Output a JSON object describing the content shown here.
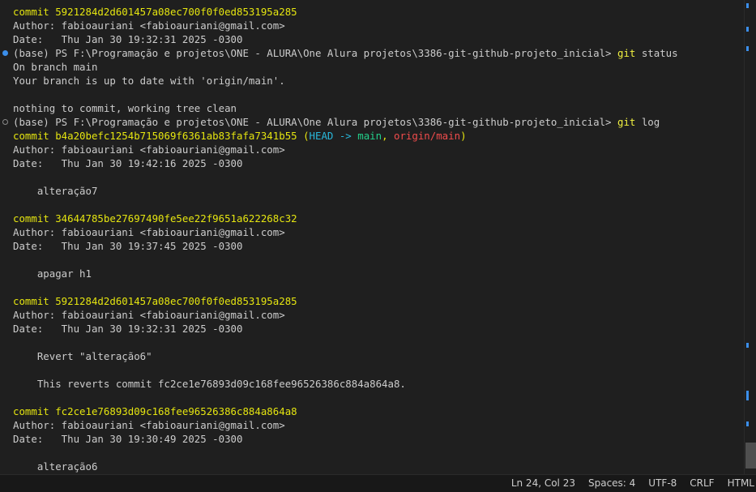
{
  "terminal": {
    "lines": [
      {
        "marker": "",
        "segments": [
          {
            "text": "commit 5921284d2d601457a08ec700f0f0ed853195a285",
            "cls": "c-commit"
          }
        ]
      },
      {
        "marker": "",
        "segments": [
          {
            "text": "Author: fabioauriani <fabioauriani@gmail.com>",
            "cls": "c-default"
          }
        ]
      },
      {
        "marker": "",
        "segments": [
          {
            "text": "Date:   Thu Jan 30 19:32:31 2025 -0300",
            "cls": "c-default"
          }
        ]
      },
      {
        "marker": "filled",
        "segments": [
          {
            "text": "(base) PS F:\\Programação e projetos\\ONE - ALURA\\One Alura projetos\\3386-git-github-projeto_inicial> ",
            "cls": "c-default"
          },
          {
            "text": "git",
            "cls": "c-cmd"
          },
          {
            "text": " status",
            "cls": "c-default"
          }
        ]
      },
      {
        "marker": "",
        "segments": [
          {
            "text": "On branch main",
            "cls": "c-default"
          }
        ]
      },
      {
        "marker": "",
        "segments": [
          {
            "text": "Your branch is up to date with 'origin/main'.",
            "cls": "c-default"
          }
        ]
      },
      {
        "marker": "",
        "segments": [
          {
            "text": "",
            "cls": "c-default"
          }
        ]
      },
      {
        "marker": "",
        "segments": [
          {
            "text": "nothing to commit, working tree clean",
            "cls": "c-default"
          }
        ]
      },
      {
        "marker": "hollow",
        "segments": [
          {
            "text": "(base) PS F:\\Programação e projetos\\ONE - ALURA\\One Alura projetos\\3386-git-github-projeto_inicial> ",
            "cls": "c-default"
          },
          {
            "text": "git",
            "cls": "c-cmd"
          },
          {
            "text": " log",
            "cls": "c-default"
          }
        ]
      },
      {
        "marker": "",
        "segments": [
          {
            "text": "commit b4a20befc1254b715069f6361ab83fafa7341b55 ",
            "cls": "c-commit"
          },
          {
            "text": "(",
            "cls": "c-commit"
          },
          {
            "text": "HEAD -> ",
            "cls": "c-head"
          },
          {
            "text": "main",
            "cls": "c-branch"
          },
          {
            "text": ", ",
            "cls": "c-commit"
          },
          {
            "text": "origin/main",
            "cls": "c-remote"
          },
          {
            "text": ")",
            "cls": "c-commit"
          }
        ]
      },
      {
        "marker": "",
        "segments": [
          {
            "text": "Author: fabioauriani <fabioauriani@gmail.com>",
            "cls": "c-default"
          }
        ]
      },
      {
        "marker": "",
        "segments": [
          {
            "text": "Date:   Thu Jan 30 19:42:16 2025 -0300",
            "cls": "c-default"
          }
        ]
      },
      {
        "marker": "",
        "segments": [
          {
            "text": "",
            "cls": "c-default"
          }
        ]
      },
      {
        "marker": "",
        "segments": [
          {
            "text": "    alteração7",
            "cls": "c-default"
          }
        ]
      },
      {
        "marker": "",
        "segments": [
          {
            "text": "",
            "cls": "c-default"
          }
        ]
      },
      {
        "marker": "",
        "segments": [
          {
            "text": "commit 34644785be27697490fe5ee22f9651a622268c32",
            "cls": "c-commit"
          }
        ]
      },
      {
        "marker": "",
        "segments": [
          {
            "text": "Author: fabioauriani <fabioauriani@gmail.com>",
            "cls": "c-default"
          }
        ]
      },
      {
        "marker": "",
        "segments": [
          {
            "text": "Date:   Thu Jan 30 19:37:45 2025 -0300",
            "cls": "c-default"
          }
        ]
      },
      {
        "marker": "",
        "segments": [
          {
            "text": "",
            "cls": "c-default"
          }
        ]
      },
      {
        "marker": "",
        "segments": [
          {
            "text": "    apagar h1",
            "cls": "c-default"
          }
        ]
      },
      {
        "marker": "",
        "segments": [
          {
            "text": "",
            "cls": "c-default"
          }
        ]
      },
      {
        "marker": "",
        "segments": [
          {
            "text": "commit 5921284d2d601457a08ec700f0f0ed853195a285",
            "cls": "c-commit"
          }
        ]
      },
      {
        "marker": "",
        "segments": [
          {
            "text": "Author: fabioauriani <fabioauriani@gmail.com>",
            "cls": "c-default"
          }
        ]
      },
      {
        "marker": "",
        "segments": [
          {
            "text": "Date:   Thu Jan 30 19:32:31 2025 -0300",
            "cls": "c-default"
          }
        ]
      },
      {
        "marker": "",
        "segments": [
          {
            "text": "",
            "cls": "c-default"
          }
        ]
      },
      {
        "marker": "",
        "segments": [
          {
            "text": "    Revert \"alteração6\"",
            "cls": "c-default"
          }
        ]
      },
      {
        "marker": "",
        "segments": [
          {
            "text": "",
            "cls": "c-default"
          }
        ]
      },
      {
        "marker": "",
        "segments": [
          {
            "text": "    This reverts commit fc2ce1e76893d09c168fee96526386c884a864a8.",
            "cls": "c-default"
          }
        ]
      },
      {
        "marker": "",
        "segments": [
          {
            "text": "",
            "cls": "c-default"
          }
        ]
      },
      {
        "marker": "",
        "segments": [
          {
            "text": "commit fc2ce1e76893d09c168fee96526386c884a864a8",
            "cls": "c-commit"
          }
        ]
      },
      {
        "marker": "",
        "segments": [
          {
            "text": "Author: fabioauriani <fabioauriani@gmail.com>",
            "cls": "c-default"
          }
        ]
      },
      {
        "marker": "",
        "segments": [
          {
            "text": "Date:   Thu Jan 30 19:30:49 2025 -0300",
            "cls": "c-default"
          }
        ]
      },
      {
        "marker": "",
        "segments": [
          {
            "text": "",
            "cls": "c-default"
          }
        ]
      },
      {
        "marker": "",
        "segments": [
          {
            "text": "    alteração6",
            "cls": "c-default"
          }
        ]
      }
    ]
  },
  "statusbar": {
    "cursor": "Ln 24, Col 23",
    "spaces": "Spaces: 4",
    "encoding": "UTF-8",
    "eol": "CRLF",
    "language": "HTML"
  },
  "colors": {
    "background": "#1f1f1f",
    "commit_yellow": "#e5e510",
    "head_cyan": "#29b8db",
    "branch_green": "#23d18b",
    "remote_red": "#f14c4c",
    "marker_blue": "#3b8eea"
  }
}
